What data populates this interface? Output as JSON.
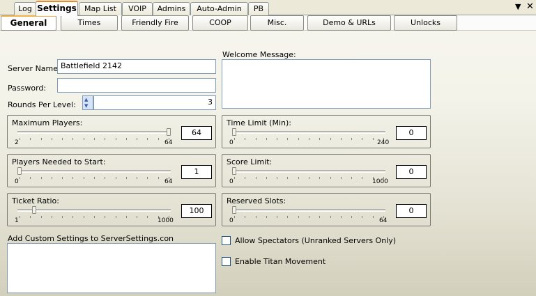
{
  "window_controls": {
    "menu": "▼",
    "close": "✕"
  },
  "tabs": [
    "Log",
    "Settings",
    "Map List",
    "VOIP",
    "Admins",
    "Auto-Admin",
    "PB"
  ],
  "subtabs": [
    "General",
    "Times",
    "Friendly Fire",
    "COOP",
    "Misc.",
    "Demo & URLs",
    "Unlocks"
  ],
  "form": {
    "server_name_label": "Server Name:",
    "server_name_value": "Battlefield 2142",
    "password_label": "Password:",
    "password_value": "",
    "rounds_label": "Rounds Per Level:",
    "rounds_value": "3",
    "welcome_label": "Welcome Message:",
    "welcome_value": "",
    "custom_label": "Add Custom Settings to ServerSettings.con",
    "custom_value": ""
  },
  "sliders": [
    {
      "key": "max_players",
      "title": "Maximum Players:",
      "min": "2",
      "max": "64",
      "value": "64",
      "fraction": 1.0
    },
    {
      "key": "players_needed",
      "title": "Players Needed to Start:",
      "min": "0",
      "max": "64",
      "value": "1",
      "fraction": 0.0
    },
    {
      "key": "ticket_ratio",
      "title": "Ticket Ratio:",
      "min": "1",
      "max": "1000",
      "value": "100",
      "fraction": 0.1
    },
    {
      "key": "time_limit",
      "title": "Time Limit (Min):",
      "min": "0",
      "max": "240",
      "value": "0",
      "fraction": 0.0
    },
    {
      "key": "score_limit",
      "title": "Score Limit:",
      "min": "0",
      "max": "1000",
      "value": "0",
      "fraction": 0.0
    },
    {
      "key": "reserved_slots",
      "title": "Reserved Slots:",
      "min": "0",
      "max": "64",
      "value": "0",
      "fraction": 0.0
    }
  ],
  "checkboxes": [
    {
      "label": "Allow Spectators (Unranked Servers Only)",
      "checked": false
    },
    {
      "label": "Enable Titan Movement",
      "checked": false
    }
  ]
}
